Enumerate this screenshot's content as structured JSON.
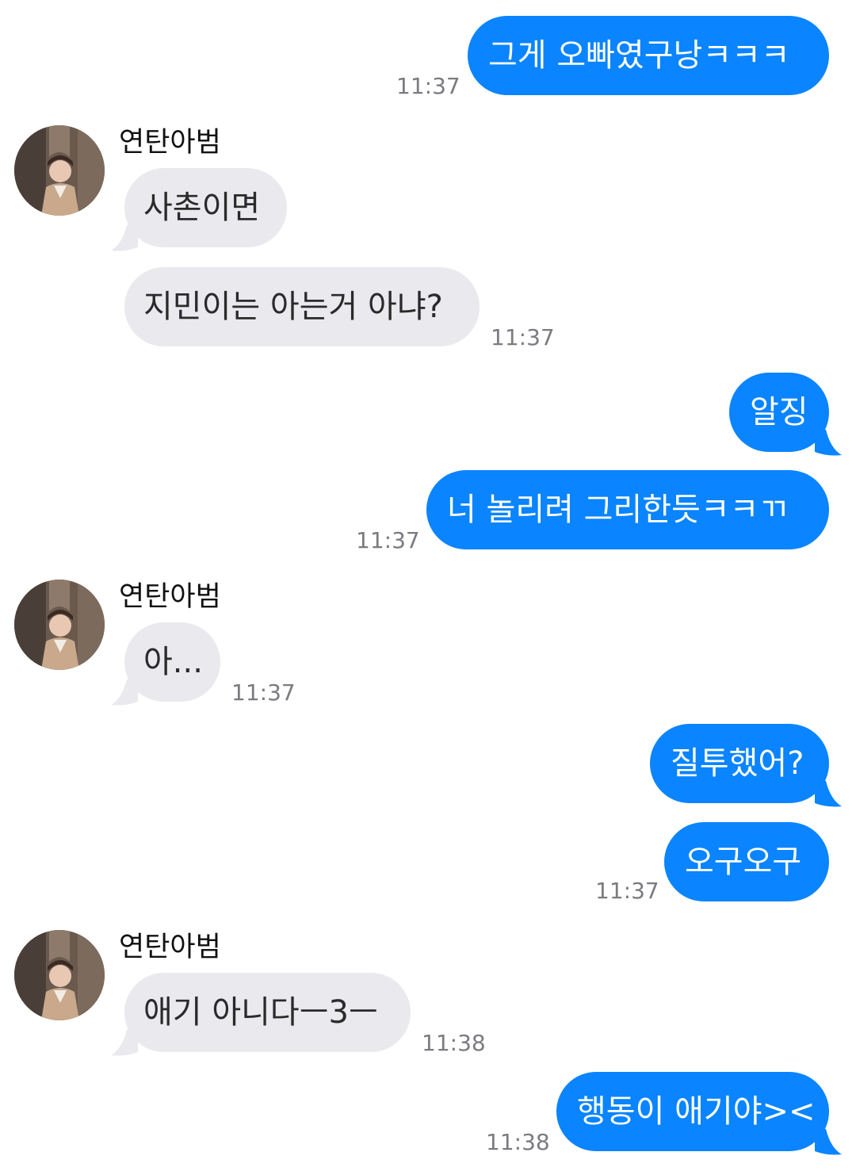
{
  "contact": {
    "name": "연탄아범"
  },
  "colors": {
    "outgoing_bubble": "#0a84ff",
    "incoming_bubble": "#e9e9ee",
    "timestamp": "#7b7b80"
  },
  "messages": [
    {
      "id": "m1",
      "direction": "out",
      "text": "그게 오빠였구낭ㅋㅋㅋ",
      "time": "11:37"
    },
    {
      "id": "m2",
      "direction": "in",
      "text": "사촌이면",
      "time": ""
    },
    {
      "id": "m3",
      "direction": "in",
      "text": "지민이는 아는거 아냐?",
      "time": "11:37"
    },
    {
      "id": "m4",
      "direction": "out",
      "text": "알징",
      "time": ""
    },
    {
      "id": "m5",
      "direction": "out",
      "text": "너 놀리려 그리한듯ㅋㅋㄲ",
      "time": "11:37"
    },
    {
      "id": "m6",
      "direction": "in",
      "text": "아...",
      "time": "11:37"
    },
    {
      "id": "m7",
      "direction": "out",
      "text": "질투했어?",
      "time": ""
    },
    {
      "id": "m8",
      "direction": "out",
      "text": "오구오구",
      "time": "11:37"
    },
    {
      "id": "m9",
      "direction": "in",
      "text": "애기 아니다ㅡ3ㅡ",
      "time": "11:38"
    },
    {
      "id": "m10",
      "direction": "out",
      "text": "행동이 애기야><",
      "time": "11:38"
    }
  ]
}
